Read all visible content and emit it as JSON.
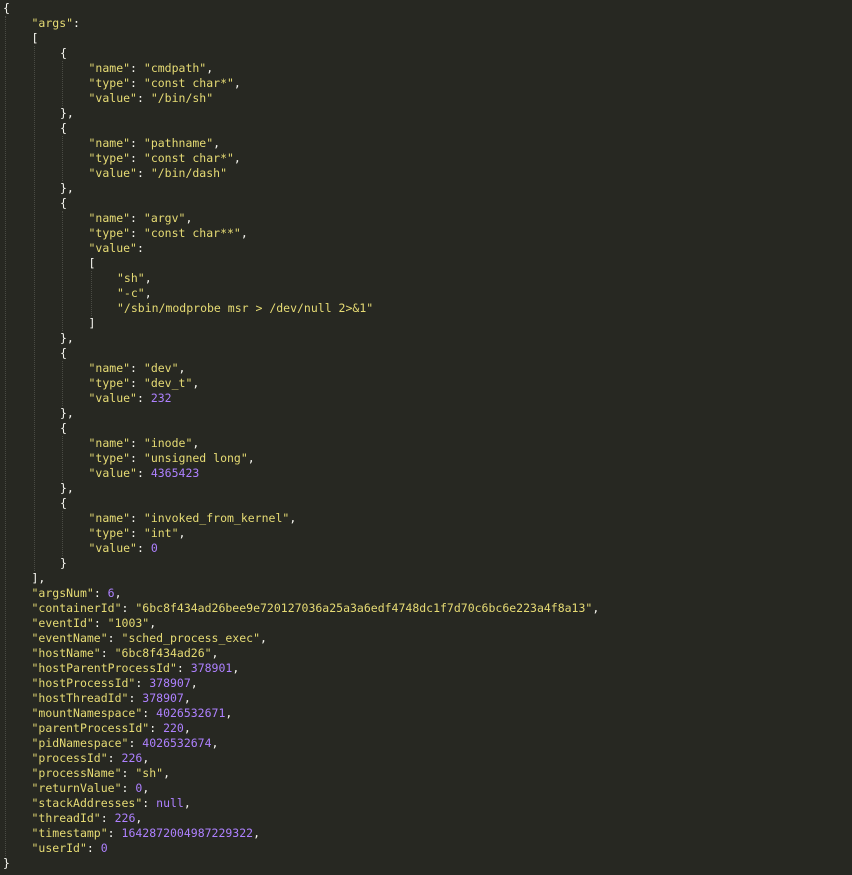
{
  "document": {
    "args_key": "\"args\"",
    "args": [
      {
        "name": "\"cmdpath\"",
        "type": "\"const char*\"",
        "value": "\"/bin/sh\"",
        "value_kind": "s"
      },
      {
        "name": "\"pathname\"",
        "type": "\"const char*\"",
        "value": "\"/bin/dash\"",
        "value_kind": "s"
      },
      {
        "name": "\"argv\"",
        "type": "\"const char**\"",
        "value_array": [
          "\"sh\"",
          "\"-c\"",
          "\"/sbin/modprobe msr > /dev/null 2>&1\""
        ]
      },
      {
        "name": "\"dev\"",
        "type": "\"dev_t\"",
        "value": "232",
        "value_kind": "n"
      },
      {
        "name": "\"inode\"",
        "type": "\"unsigned long\"",
        "value": "4365423",
        "value_kind": "n"
      },
      {
        "name": "\"invoked_from_kernel\"",
        "type": "\"int\"",
        "value": "0",
        "value_kind": "n"
      }
    ],
    "field_keys": {
      "name": "\"name\"",
      "type": "\"type\"",
      "value": "\"value\""
    },
    "fields": [
      {
        "key": "\"argsNum\"",
        "value": "6",
        "kind": "n"
      },
      {
        "key": "\"containerId\"",
        "value": "\"6bc8f434ad26bee9e720127036a25a3a6edf4748dc1f7d70c6bc6e223a4f8a13\"",
        "kind": "s"
      },
      {
        "key": "\"eventId\"",
        "value": "\"1003\"",
        "kind": "s"
      },
      {
        "key": "\"eventName\"",
        "value": "\"sched_process_exec\"",
        "kind": "s"
      },
      {
        "key": "\"hostName\"",
        "value": "\"6bc8f434ad26\"",
        "kind": "s"
      },
      {
        "key": "\"hostParentProcessId\"",
        "value": "378901",
        "kind": "n"
      },
      {
        "key": "\"hostProcessId\"",
        "value": "378907",
        "kind": "n"
      },
      {
        "key": "\"hostThreadId\"",
        "value": "378907",
        "kind": "n"
      },
      {
        "key": "\"mountNamespace\"",
        "value": "4026532671",
        "kind": "n"
      },
      {
        "key": "\"parentProcessId\"",
        "value": "220",
        "kind": "n"
      },
      {
        "key": "\"pidNamespace\"",
        "value": "4026532674",
        "kind": "n"
      },
      {
        "key": "\"processId\"",
        "value": "226",
        "kind": "n"
      },
      {
        "key": "\"processName\"",
        "value": "\"sh\"",
        "kind": "s"
      },
      {
        "key": "\"returnValue\"",
        "value": "0",
        "kind": "n"
      },
      {
        "key": "\"stackAddresses\"",
        "value": "null",
        "kind": "c"
      },
      {
        "key": "\"threadId\"",
        "value": "226",
        "kind": "n"
      },
      {
        "key": "\"timestamp\"",
        "value": "1642872004987229322",
        "kind": "n"
      },
      {
        "key": "\"userId\"",
        "value": "0",
        "kind": "n"
      }
    ]
  },
  "theme": {
    "background": "#272822",
    "punctuation": "#f8f8f2",
    "string": "#e6db74",
    "number": "#ae81ff",
    "indent_guide": "#4a4b44"
  }
}
